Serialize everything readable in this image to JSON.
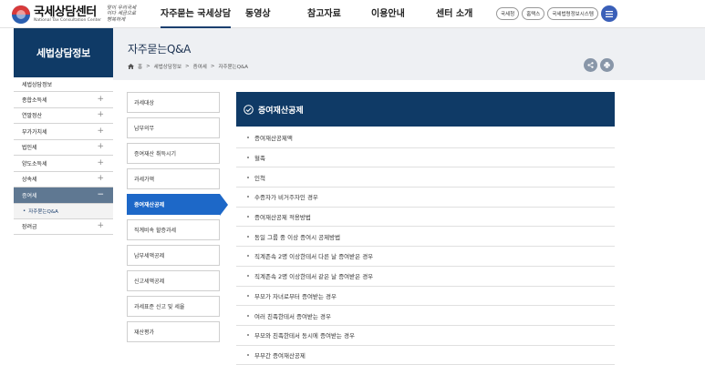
{
  "header": {
    "logo_kr": "국세상담센터",
    "logo_en": "National Tax Consultation Center",
    "slogan": "맞이 우리국세이다 세금으로 행복하게",
    "gnb": [
      {
        "label": "자주묻는 국세상담",
        "active": true
      },
      {
        "label": "동영상",
        "active": false
      },
      {
        "label": "참고자료",
        "active": false
      },
      {
        "label": "이용안내",
        "active": false
      },
      {
        "label": "센터 소개",
        "active": false
      }
    ],
    "util": [
      "국세청",
      "홈택스",
      "국세법령정보시스템"
    ],
    "menu_icon": "hamburger-icon"
  },
  "sidebar": {
    "title": "세법상담정보",
    "head": "세법상담정보",
    "items": [
      {
        "label": "종합소득세",
        "toggle": "+",
        "active": false
      },
      {
        "label": "연말정산",
        "toggle": "+",
        "active": false
      },
      {
        "label": "부가가치세",
        "toggle": "+",
        "active": false
      },
      {
        "label": "법인세",
        "toggle": "+",
        "active": false
      },
      {
        "label": "양도소득세",
        "toggle": "+",
        "active": false
      },
      {
        "label": "상속세",
        "toggle": "+",
        "active": false
      },
      {
        "label": "증여세",
        "toggle": "−",
        "active": true
      }
    ],
    "sub_item": "자주묻는Q&A",
    "after": {
      "label": "장려금",
      "toggle": "+"
    }
  },
  "page": {
    "title": "자주묻는Q&A",
    "breadcrumb": [
      "홈",
      "세법상담정보",
      "증여세",
      "자주묻는Q&A"
    ],
    "breadcrumb_sep": ">"
  },
  "categories": [
    {
      "label": "과세대상",
      "active": false
    },
    {
      "label": "납부의무",
      "active": false
    },
    {
      "label": "증여재산 취득시기",
      "active": false
    },
    {
      "label": "과세가액",
      "active": false
    },
    {
      "label": "증여재산공제",
      "active": true
    },
    {
      "label": "직계비속 할증과세",
      "active": false
    },
    {
      "label": "납부세액공제",
      "active": false
    },
    {
      "label": "신고세액공제",
      "active": false
    },
    {
      "label": "과세표준 신고 및 세율",
      "active": false
    },
    {
      "label": "재산평가",
      "active": false
    }
  ],
  "content": {
    "heading": "증여재산공제",
    "items": [
      "증여재산공제액",
      "혈족",
      "인척",
      "수증자가 비거주자인 경우",
      "증여재산공제 적용방법",
      "동일 그룹 중 이상 증여시 공제방법",
      "직계존속 2명 이상한테서 다른 날 증여받은 경우",
      "직계존속 2명 이상한테서 같은 날 증여받은 경우",
      "부모가 자녀로부터 증여받는 경우",
      "여러 친족한테서 증여받는 경우",
      "부모와 친족한테서 동시에 증여받는 경우",
      "부부간 증여재산공제"
    ]
  },
  "colors": {
    "navy": "#0f3a66",
    "accent_blue": "#1d68c8",
    "lnb_active": "#5f7892"
  }
}
